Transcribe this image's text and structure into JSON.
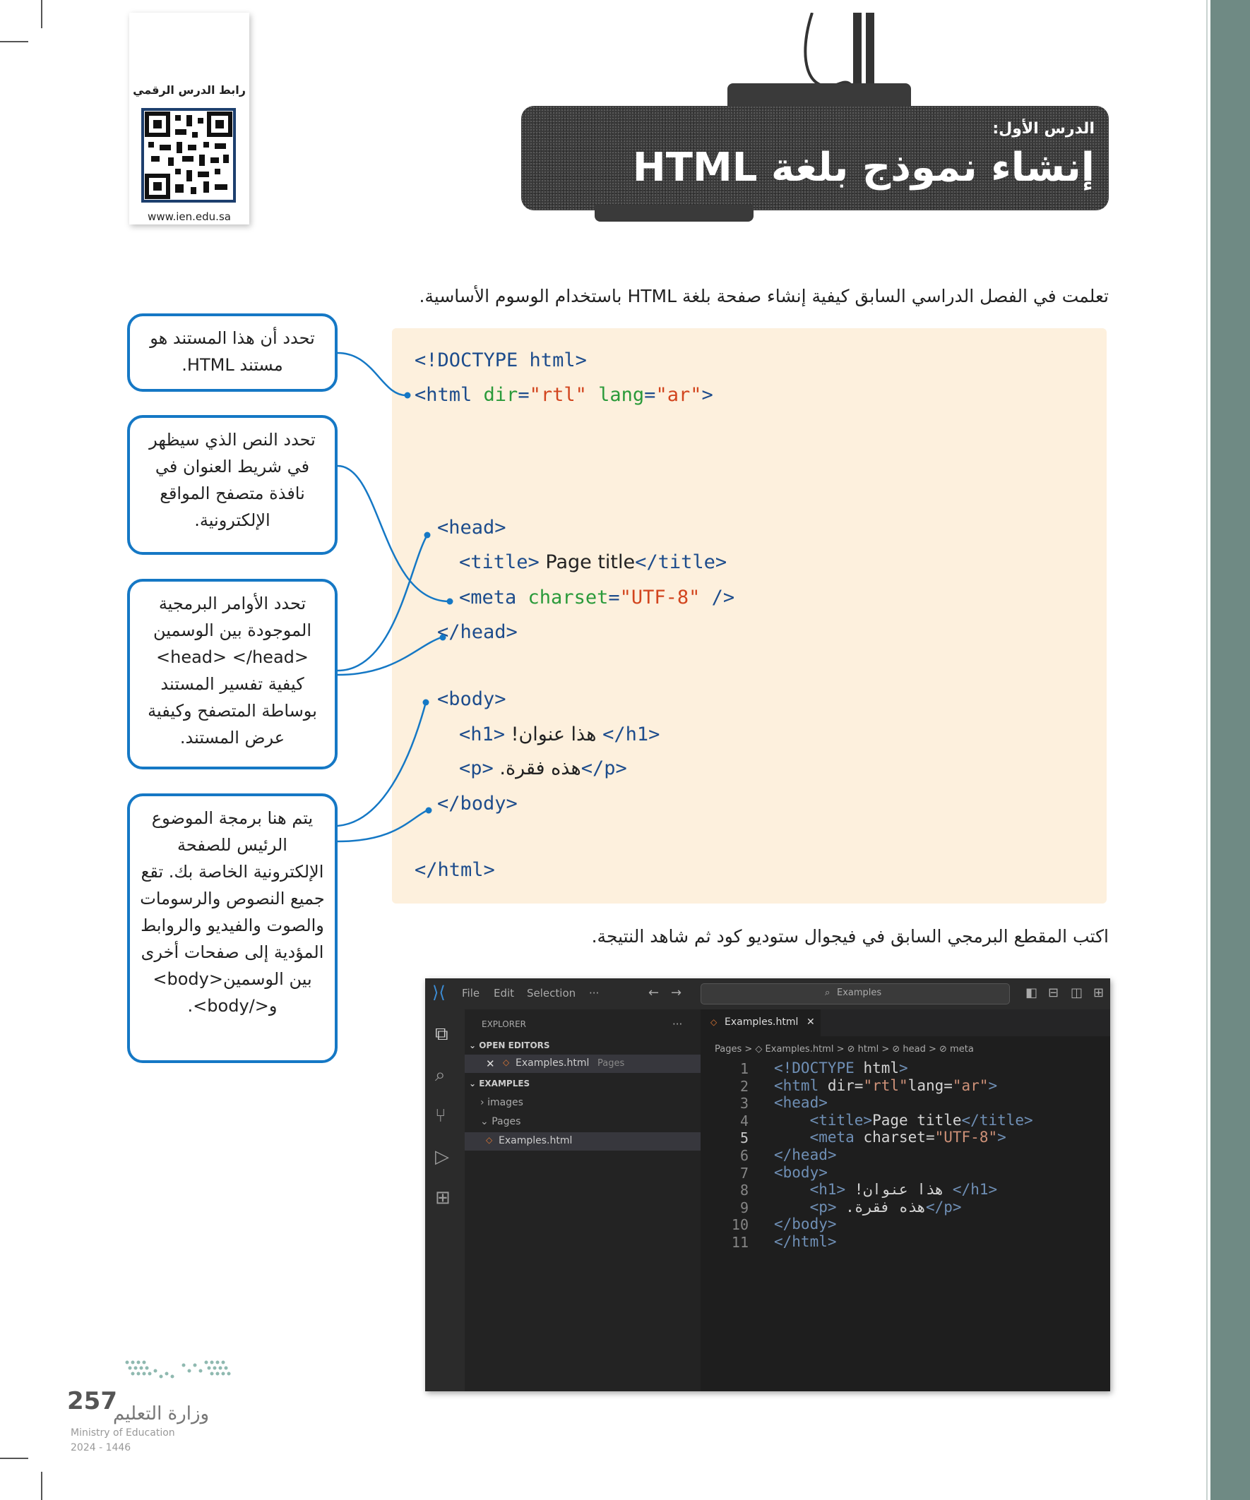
{
  "qr": {
    "label": "رابط الدرس الرقمي",
    "url": "www.ien.edu.sa"
  },
  "banner": {
    "lesson_label": "الدرس الأول:",
    "title": "إنشاء نموذج بلغة HTML"
  },
  "intro": "تعلمت في الفصل الدراسي السابق كيفية إنشاء صفحة بلغة HTML باستخدام الوسوم الأساسية.",
  "instruction": "اكتب المقطع البرمجي السابق في فيجوال ستوديو كود ثم شاهد النتيجة.",
  "code": {
    "doctype": "<!DOCTYPE html>",
    "html_open_tag": "<html ",
    "html_dir_attr": "dir",
    "html_dir_val": "\"rtl\"",
    "html_lang_attr": "lang",
    "html_lang_val": "\"ar\"",
    "head_open": "<head>",
    "title_open": "<title>",
    "title_text": " Page title",
    "title_close": "</title>",
    "meta_open": "<meta ",
    "meta_attr": "charset",
    "meta_val": "\"UTF-8\"",
    "meta_close": " />",
    "head_close": "</head>",
    "body_open": "<body>",
    "h1_open": "<h1>",
    "h1_text": " !هذا عنوان ",
    "h1_close": "</h1>",
    "p_open": "<p>",
    "p_text": " .هذه فقرة",
    "p_close": "</p>",
    "body_close": "</body>",
    "html_close": "</html>"
  },
  "callouts": [
    "تحدد أن هذا المستند هو مستند HTML.",
    "تحدد النص الذي سيظهر في شريط العنوان في نافذة متصفح المواقع الإلكترونية.",
    "تحدد الأوامر البرمجية الموجودة بين الوسمين <head> </head> كيفية تفسير المستند بوساطة المتصفح وكيفية عرض المستند.",
    "يتم هنا برمجة الموضوع الرئيس للصفحة الإلكترونية الخاصة بك. تقع جميع النصوص والرسومات والصوت والفيديو والروابط المؤدية إلى صفحات أخرى بين الوسمين<body> و</body>."
  ],
  "vscode": {
    "menu": [
      "File",
      "Edit",
      "Selection",
      "···"
    ],
    "search": "Examples",
    "explorer_label": "EXPLORER",
    "explorer_more": "···",
    "open_editors": "OPEN EDITORS",
    "open_file": "Examples.html",
    "open_file_folder": "Pages",
    "examples_folder": "EXAMPLES",
    "images_folder": "images",
    "pages_folder": "Pages",
    "tree_file": "Examples.html",
    "tab_name": "Examples.html",
    "breadcrumb": "Pages > ◇ Examples.html > ⊘ html > ⊘ head > ⊘ meta",
    "lines": [
      {
        "n": "1",
        "parts": [
          [
            "tag",
            "<!DOCTYPE "
          ],
          [
            "name",
            "html"
          ],
          [
            "tag",
            ">"
          ]
        ]
      },
      {
        "n": "2",
        "parts": [
          [
            "tag",
            "<html "
          ],
          [
            "name",
            "dir"
          ],
          [
            "plain",
            "="
          ],
          [
            "str",
            "\"rtl\""
          ],
          [
            "name",
            "lang"
          ],
          [
            "plain",
            "="
          ],
          [
            "str",
            "\"ar\""
          ],
          [
            "tag",
            ">"
          ]
        ]
      },
      {
        "n": "3",
        "parts": [
          [
            "tag",
            "<head>"
          ]
        ]
      },
      {
        "n": "4",
        "parts": [
          [
            "plain",
            "    "
          ],
          [
            "tag",
            "<title>"
          ],
          [
            "plain",
            "Page title"
          ],
          [
            "tag",
            "</title>"
          ]
        ]
      },
      {
        "n": "5",
        "parts": [
          [
            "plain",
            "    "
          ],
          [
            "tag",
            "<meta "
          ],
          [
            "name",
            "charset"
          ],
          [
            "plain",
            "="
          ],
          [
            "str",
            "\"UTF-8\""
          ],
          [
            "tag",
            ">"
          ]
        ]
      },
      {
        "n": "6",
        "parts": [
          [
            "tag",
            "</head>"
          ]
        ]
      },
      {
        "n": "7",
        "parts": [
          [
            "tag",
            "<body>"
          ]
        ]
      },
      {
        "n": "8",
        "parts": [
          [
            "plain",
            "    "
          ],
          [
            "tag",
            "<h1>"
          ],
          [
            "plain",
            " !هذا عنوان "
          ],
          [
            "tag",
            "</h1>"
          ]
        ]
      },
      {
        "n": "9",
        "parts": [
          [
            "plain",
            "    "
          ],
          [
            "tag",
            "<p>"
          ],
          [
            "plain",
            " .هذه فقرة"
          ],
          [
            "tag",
            "</p>"
          ]
        ]
      },
      {
        "n": "10",
        "parts": [
          [
            "tag",
            "</body>"
          ]
        ]
      },
      {
        "n": "11",
        "parts": [
          [
            "tag",
            "</html>"
          ]
        ]
      }
    ]
  },
  "footer": {
    "page_number": "257",
    "ministry_ar": "وزارة التعليم",
    "ministry_en": "Ministry of Education",
    "years": "2024 - 1446"
  }
}
